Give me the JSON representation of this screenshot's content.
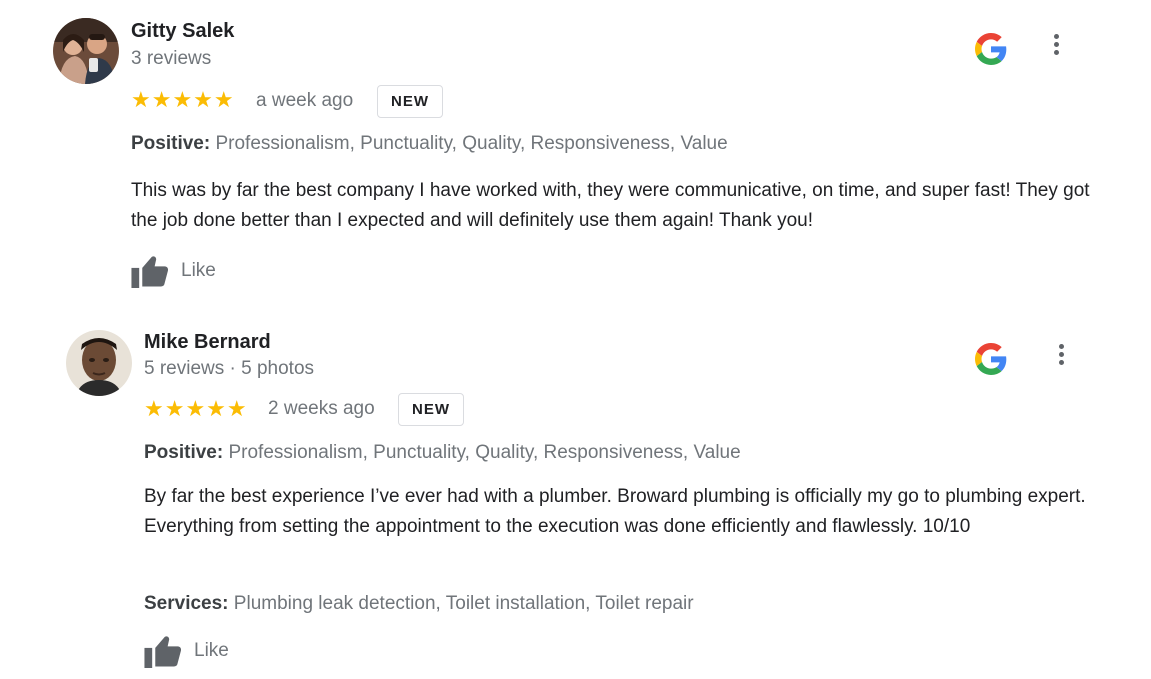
{
  "reviews": [
    {
      "author": "Gitty Salek",
      "meta": "3 reviews",
      "stars": "★★★★★",
      "date": "a week ago",
      "badge": "NEW",
      "positive_label": "Positive:",
      "positive_value": "Professionalism, Punctuality, Quality, Responsiveness, Value",
      "text": "This was by far the best company I have worked with, they were communicative, on time, and super fast! They got the job done better than I expected and will definitely use them again! Thank you!",
      "like_label": "Like",
      "rating": 5
    },
    {
      "author": "Mike Bernard",
      "meta": "5 reviews · 5 photos",
      "stars": "★★★★★",
      "date": "2 weeks ago",
      "badge": "NEW",
      "positive_label": "Positive:",
      "positive_value": "Professionalism, Punctuality, Quality, Responsiveness, Value",
      "text": "By far the best experience I’ve ever had with a plumber. Broward plumbing is officially my go to plumbing expert. Everything from setting the appointment to the execution was done efficiently and flawlessly. 10/10",
      "services_label": "Services:",
      "services_value": "Plumbing leak detection, Toilet installation, Toilet repair",
      "like_label": "Like",
      "rating": 5
    }
  ],
  "colors": {
    "star": "#fbbc04",
    "google_blue": "#4285f4",
    "google_red": "#ea4335",
    "google_yellow": "#fbbc05",
    "google_green": "#34a853"
  }
}
